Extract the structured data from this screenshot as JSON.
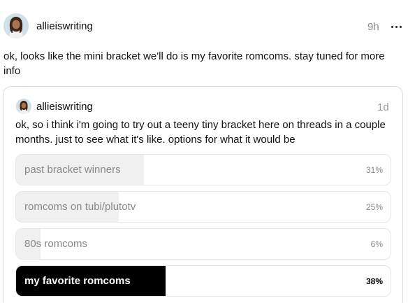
{
  "post": {
    "username": "allieiswriting",
    "time": "9h",
    "text": "ok, looks like the mini bracket we'll do is my favorite romcoms. stay tuned for more info"
  },
  "quote": {
    "username": "allieiswriting",
    "time": "1d",
    "text": "ok, so i think i'm going to try out a teeny tiny bracket here on threads in a couple months. just to see what it's like. options for what it would be",
    "poll": [
      {
        "label": "past bracket winners",
        "percent": "31%",
        "value": 31,
        "winner": false
      },
      {
        "label": "romcoms on tubi/plutotv",
        "percent": "25%",
        "value": 25,
        "winner": false
      },
      {
        "label": "80s romcoms",
        "percent": "6%",
        "value": 6,
        "winner": false
      },
      {
        "label": "my favorite romcoms",
        "percent": "38%",
        "value": 38,
        "winner": true
      }
    ]
  },
  "icons": {
    "more": "more-horizontal-icon",
    "avatar": "avatar-image"
  },
  "colors": {
    "winner_fill": "#000000",
    "poll_fill": "#f0f0f0",
    "muted_text": "#888888"
  }
}
